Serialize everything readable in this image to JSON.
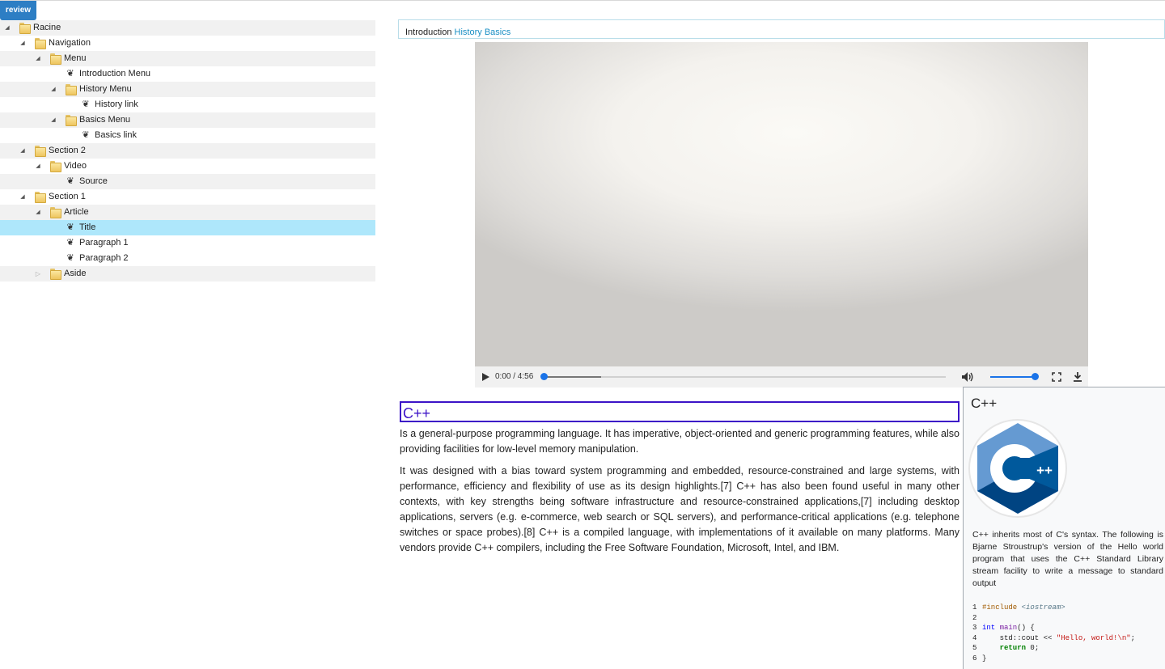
{
  "toolbar": {
    "review_label": "review"
  },
  "tree": {
    "racine": "Racine",
    "navigation": "Navigation",
    "menu": "Menu",
    "intro_menu": "Introduction Menu",
    "history_menu": "History Menu",
    "history_link": "History link",
    "basics_menu": "Basics Menu",
    "basics_link": "Basics link",
    "section2": "Section 2",
    "video": "Video",
    "source": "Source",
    "section1": "Section 1",
    "article": "Article",
    "title": "Title",
    "paragraph1": "Paragraph 1",
    "paragraph2": "Paragraph 2",
    "aside": "Aside"
  },
  "breadcrumb": {
    "introduction": "Introduction",
    "history": "History",
    "basics": "Basics"
  },
  "video": {
    "time": "0:00 / 4:56",
    "progress": 0.0,
    "volume": 1.0
  },
  "article": {
    "title": "C++",
    "paragraph1": "Is a general-purpose programming language. It has imperative, object-oriented and generic programming features, while also providing facilities for low-level memory manipulation.",
    "paragraph2": "It was designed with a bias toward system programming and embedded, resource-constrained and large systems, with performance, efficiency and flexibility of use as its design highlights.[7] C++ has also been found useful in many other contexts, with key strengths being software infrastructure and resource-constrained applications,[7] including desktop applications, servers (e.g. e-commerce, web search or SQL servers), and performance-critical applications (e.g. telephone switches or space probes).[8] C++ is a compiled language, with implementations of it available on many platforms. Many vendors provide C++ compilers, including the Free Software Foundation, Microsoft, Intel, and IBM."
  },
  "aside": {
    "title": "C++",
    "logo_text": "++",
    "text": "C++ inherits most of C's syntax. The following is Bjarne Stroustrup's version of the Hello world program that uses the C++ Standard Library stream facility to write a message to standard output",
    "code": {
      "l1_num": "1",
      "l1_pre": "#include",
      "l1_inc": "<iostream>",
      "l2_num": "2",
      "l3_num": "3",
      "l3_type": "int",
      "l3_fn": "main",
      "l3_rest": "() {",
      "l4_num": "4",
      "l4_a": "    std::cout << ",
      "l4_str": "\"Hello, world!\\n\"",
      "l4_end": ";",
      "l5_num": "5",
      "l5_ret": "return",
      "l5_rest": " 0;",
      "l6_num": "6",
      "l6_rest": "}"
    }
  },
  "colors": {
    "accent": "#2d7ec4",
    "selected_row": "#aee7fb",
    "title_border": "#3c13c7",
    "link": "#1a8fc4"
  }
}
